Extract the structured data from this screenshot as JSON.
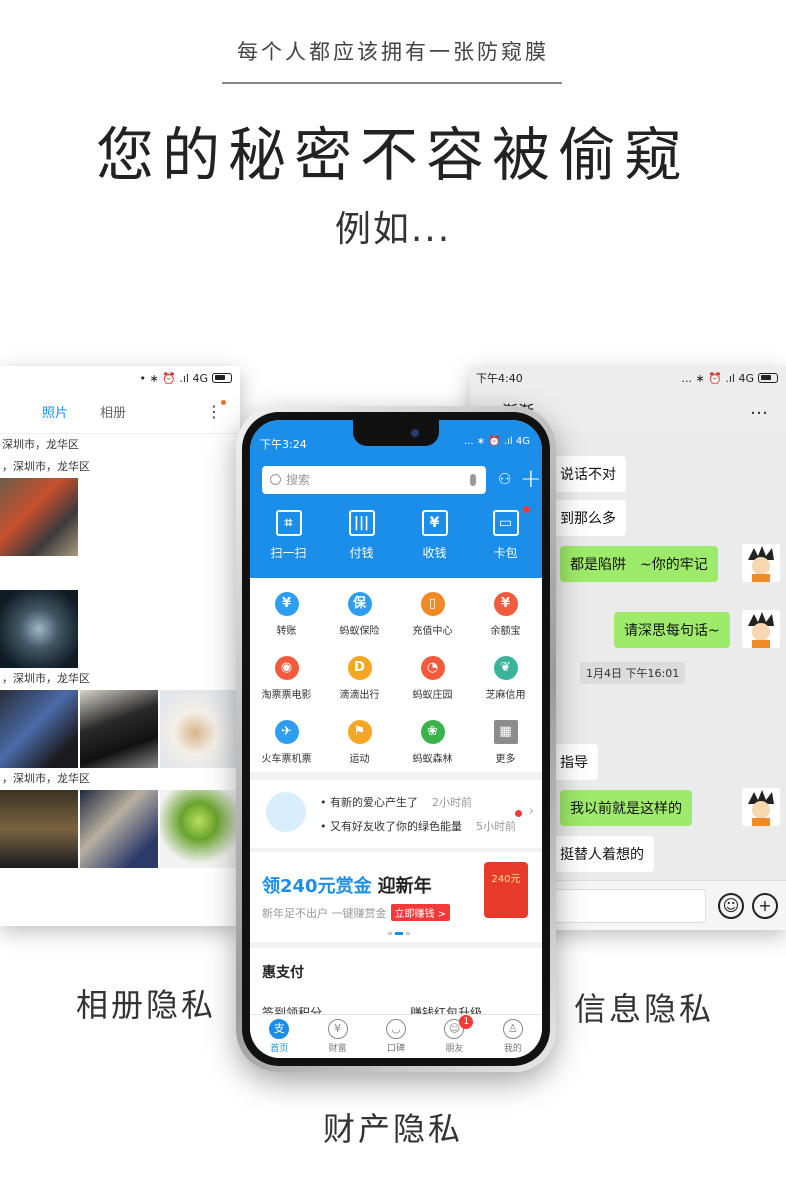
{
  "header": {
    "tagline": "每个人都应该拥有一张防窥膜",
    "headline": "您的秘密不容被偷窥",
    "subhead": "例如..."
  },
  "captions": {
    "album": "相册隐私",
    "message": "信息隐私",
    "money": "财产隐私"
  },
  "album_screen": {
    "status_icons": "• ∗ ⏰ .ıl 4G",
    "tabs": [
      "照片",
      "相册"
    ],
    "more_icon": "kebab-icon",
    "locations": [
      "深圳市，龙华区",
      "，深圳市，龙华区",
      "，深圳市，龙华区",
      "，深圳市，龙华区"
    ]
  },
  "chat_screen": {
    "status_time": "下午4:40",
    "status_icons": "... ∗ ⏰ .ıl 4G",
    "contact_name": "渐渐",
    "more_icon": "…",
    "messages": [
      {
        "dir": "in",
        "text": "说话不对"
      },
      {
        "dir": "in",
        "text": "到那么多"
      },
      {
        "dir": "out",
        "text": "都是陷阱　~你的牢记"
      },
      {
        "dir": "out",
        "text": "请深思每句话~"
      },
      {
        "dir": "in",
        "text": "指导"
      },
      {
        "dir": "out",
        "text": "我以前就是这样的"
      },
      {
        "dir": "in",
        "text": "挺替人着想的"
      }
    ],
    "timestamp": "1月4日 下午16:01"
  },
  "alipay_screen": {
    "status_time": "下午3:24",
    "status_icons": "... ∗ ⏰ .ıl 4G",
    "search_placeholder": "搜索",
    "main_actions": [
      "扫一扫",
      "付钱",
      "收钱",
      "卡包"
    ],
    "grid": [
      {
        "label": "转账",
        "color": "#2e9df2"
      },
      {
        "label": "蚂蚁保险",
        "color": "#2e9df2"
      },
      {
        "label": "充值中心",
        "color": "#f08a24"
      },
      {
        "label": "余额宝",
        "color": "#f35b3c"
      },
      {
        "label": "淘票票电影",
        "color": "#f35b3c"
      },
      {
        "label": "滴滴出行",
        "color": "#f5a623"
      },
      {
        "label": "蚂蚁庄园",
        "color": "#f35b3c"
      },
      {
        "label": "芝麻信用",
        "color": "#3bb39b"
      },
      {
        "label": "火车票机票",
        "color": "#2e9df2"
      },
      {
        "label": "运动",
        "color": "#f5a623"
      },
      {
        "label": "蚂蚁森林",
        "color": "#3bb34a"
      },
      {
        "label": "更多",
        "color": "#8c8c8c"
      }
    ],
    "notices": [
      {
        "text": "• 有新的爱心产生了",
        "time": "2小时前"
      },
      {
        "text": "• 又有好友收了你的绿色能量",
        "time": "5小时前"
      }
    ],
    "promo": {
      "title": "领240元赏金",
      "title_accent": "迎新年",
      "subtitle": "新年足不出户 一键赚赏金",
      "button": "立即赚钱 >",
      "envelope_value": "240元"
    },
    "section_title": "惠支付",
    "section_items": [
      "签到领积分",
      "赚钱红包升级"
    ],
    "tabs": [
      "首页",
      "财富",
      "口碑",
      "朋友",
      "我的"
    ],
    "friend_badge": "1"
  }
}
